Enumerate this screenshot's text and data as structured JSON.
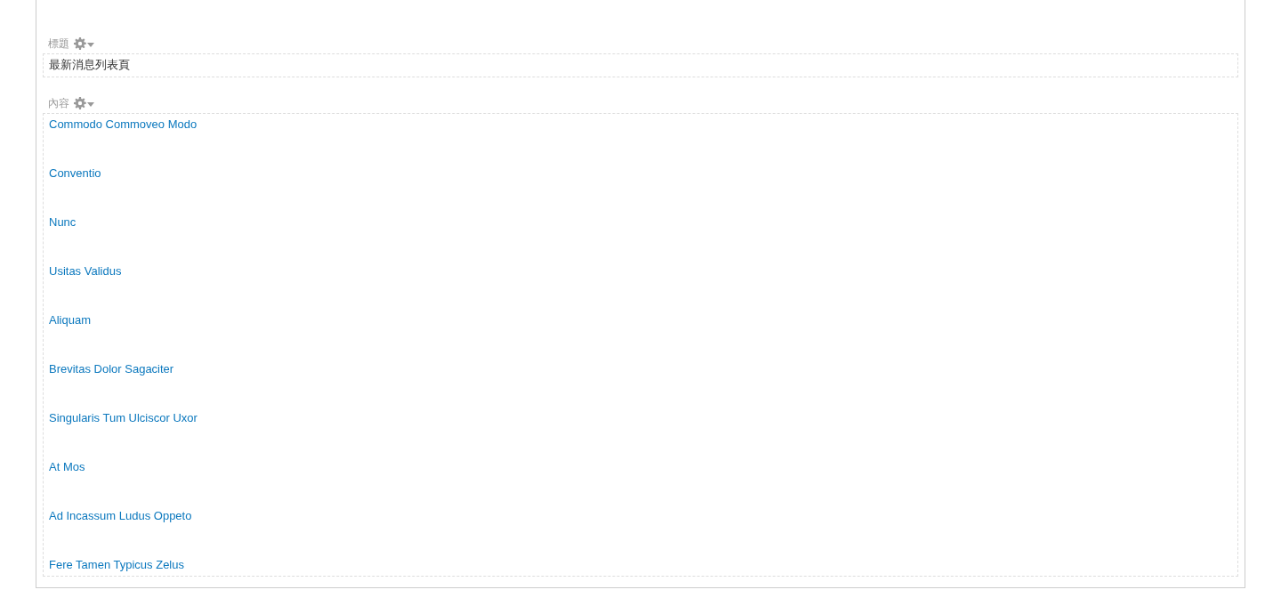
{
  "fields": [
    {
      "kind": "text",
      "label": "標題",
      "value": "最新消息列表頁"
    },
    {
      "kind": "links",
      "label": "內容",
      "items": [
        "Commodo Commoveo Modo",
        "Conventio",
        "Nunc",
        "Usitas Validus",
        "Aliquam",
        "Brevitas Dolor Sagaciter",
        "Singularis Tum Ulciscor Uxor",
        "At Mos",
        "Ad Incassum Ludus Oppeto",
        "Fere Tamen Typicus Zelus"
      ]
    }
  ]
}
